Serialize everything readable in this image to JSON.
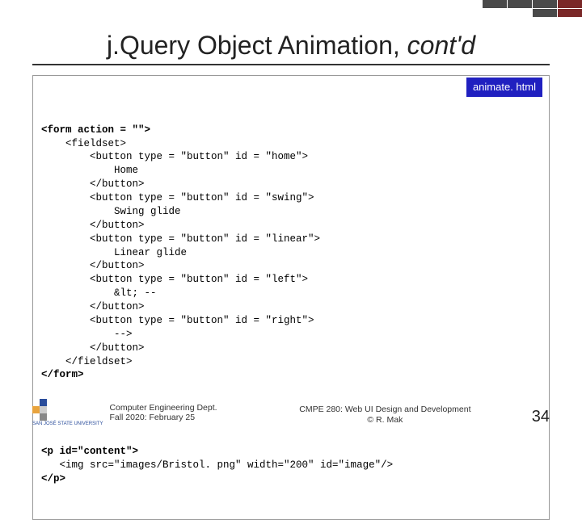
{
  "title_prefix": "j.Query Object Animation, ",
  "title_italic": "cont'd",
  "filename": "animate. html",
  "code_lines": [
    "<form action = \"\">",
    "    <fieldset>",
    "        <button type = \"button\" id = \"home\">",
    "            Home",
    "        </button>",
    "        <button type = \"button\" id = \"swing\">",
    "            Swing glide",
    "        </button>",
    "        <button type = \"button\" id = \"linear\">",
    "            Linear glide",
    "        </button>",
    "        <button type = \"button\" id = \"left\">",
    "            &lt; --",
    "        </button>",
    "        <button type = \"button\" id = \"right\">",
    "            -->",
    "        </button>",
    "    </fieldset>",
    "</form>"
  ],
  "code_lines2": [
    "<p id=\"content\">",
    "   <img src=\"images/Bristol. png\" width=\"200\" id=\"image\"/>",
    "</p>"
  ],
  "footer": {
    "dept": "Computer Engineering Dept.",
    "term": "Fall 2020: February 25",
    "course": "CMPE 280: Web UI Design and Development",
    "author": "© R. Mak",
    "logo_caption": "SAN JOSÉ STATE\nUNIVERSITY",
    "page": "34"
  }
}
